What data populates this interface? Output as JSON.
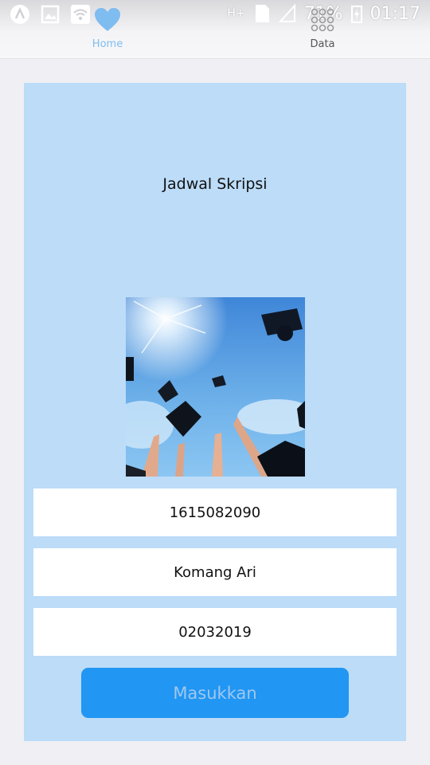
{
  "status_bar": {
    "icons": [
      "launcher-icon",
      "gallery-icon",
      "wifi-icon"
    ],
    "network": "H+",
    "sim": "1",
    "battery": "71%",
    "time": "01:17"
  },
  "tabs": [
    {
      "label": "Home",
      "icon": "heart-icon",
      "active": true
    },
    {
      "label": "Data",
      "icon": "grid-icon",
      "active": false
    }
  ],
  "card": {
    "title": "Jadwal Skripsi",
    "image": "graduation-caps-photo",
    "fields": [
      {
        "value": "1615082090"
      },
      {
        "value": "Komang Ari"
      },
      {
        "value": "02032019"
      }
    ],
    "submit_label": "Masukkan"
  },
  "colors": {
    "card_bg": "#bcdcf8",
    "button_bg": "#2196f3",
    "active_tab": "#7fbcf0"
  }
}
